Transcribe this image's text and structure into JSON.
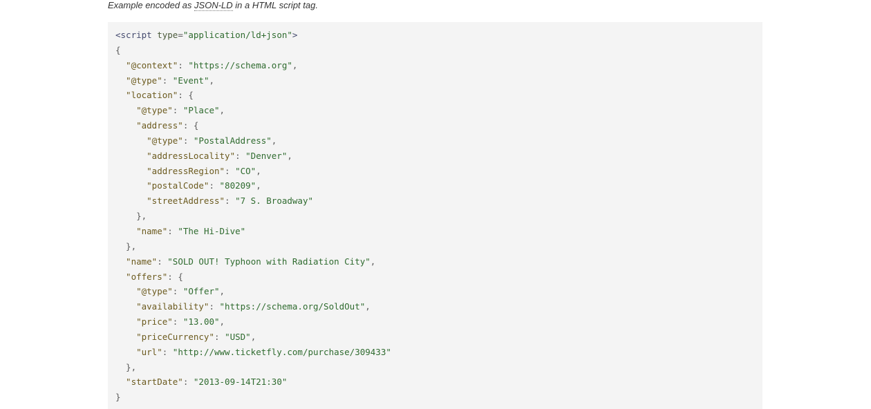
{
  "caption": {
    "prefix": "Example encoded as ",
    "term": "JSON-LD",
    "suffix": " in a HTML script tag."
  },
  "code": {
    "lines": [
      [
        {
          "t": "<script ",
          "c": "tag"
        },
        {
          "t": "type",
          "c": "attr"
        },
        {
          "t": "=",
          "c": "punc"
        },
        {
          "t": "\"application/ld+json\"",
          "c": "str"
        },
        {
          "t": ">",
          "c": "tag"
        }
      ],
      [
        {
          "t": "{",
          "c": "punc"
        }
      ],
      [
        {
          "t": "  \"@context\"",
          "c": "key"
        },
        {
          "t": ": ",
          "c": "punc"
        },
        {
          "t": "\"https://schema.org\"",
          "c": "str"
        },
        {
          "t": ",",
          "c": "punc"
        }
      ],
      [
        {
          "t": "  \"@type\"",
          "c": "key"
        },
        {
          "t": ": ",
          "c": "punc"
        },
        {
          "t": "\"Event\"",
          "c": "str"
        },
        {
          "t": ",",
          "c": "punc"
        }
      ],
      [
        {
          "t": "  \"location\"",
          "c": "key"
        },
        {
          "t": ": {",
          "c": "punc"
        }
      ],
      [
        {
          "t": "    \"@type\"",
          "c": "key"
        },
        {
          "t": ": ",
          "c": "punc"
        },
        {
          "t": "\"Place\"",
          "c": "str"
        },
        {
          "t": ",",
          "c": "punc"
        }
      ],
      [
        {
          "t": "    \"address\"",
          "c": "key"
        },
        {
          "t": ": {",
          "c": "punc"
        }
      ],
      [
        {
          "t": "      \"@type\"",
          "c": "key"
        },
        {
          "t": ": ",
          "c": "punc"
        },
        {
          "t": "\"PostalAddress\"",
          "c": "str"
        },
        {
          "t": ",",
          "c": "punc"
        }
      ],
      [
        {
          "t": "      \"addressLocality\"",
          "c": "key"
        },
        {
          "t": ": ",
          "c": "punc"
        },
        {
          "t": "\"Denver\"",
          "c": "str"
        },
        {
          "t": ",",
          "c": "punc"
        }
      ],
      [
        {
          "t": "      \"addressRegion\"",
          "c": "key"
        },
        {
          "t": ": ",
          "c": "punc"
        },
        {
          "t": "\"CO\"",
          "c": "str"
        },
        {
          "t": ",",
          "c": "punc"
        }
      ],
      [
        {
          "t": "      \"postalCode\"",
          "c": "key"
        },
        {
          "t": ": ",
          "c": "punc"
        },
        {
          "t": "\"80209\"",
          "c": "str"
        },
        {
          "t": ",",
          "c": "punc"
        }
      ],
      [
        {
          "t": "      \"streetAddress\"",
          "c": "key"
        },
        {
          "t": ": ",
          "c": "punc"
        },
        {
          "t": "\"7 S. Broadway\"",
          "c": "str"
        }
      ],
      [
        {
          "t": "    },",
          "c": "punc"
        }
      ],
      [
        {
          "t": "    \"name\"",
          "c": "key"
        },
        {
          "t": ": ",
          "c": "punc"
        },
        {
          "t": "\"The Hi-Dive\"",
          "c": "str"
        }
      ],
      [
        {
          "t": "  },",
          "c": "punc"
        }
      ],
      [
        {
          "t": "  \"name\"",
          "c": "key"
        },
        {
          "t": ": ",
          "c": "punc"
        },
        {
          "t": "\"SOLD OUT! Typhoon with Radiation City\"",
          "c": "str"
        },
        {
          "t": ",",
          "c": "punc"
        }
      ],
      [
        {
          "t": "  \"offers\"",
          "c": "key"
        },
        {
          "t": ": {",
          "c": "punc"
        }
      ],
      [
        {
          "t": "    \"@type\"",
          "c": "key"
        },
        {
          "t": ": ",
          "c": "punc"
        },
        {
          "t": "\"Offer\"",
          "c": "str"
        },
        {
          "t": ",",
          "c": "punc"
        }
      ],
      [
        {
          "t": "    \"availability\"",
          "c": "key"
        },
        {
          "t": ": ",
          "c": "punc"
        },
        {
          "t": "\"https://schema.org/SoldOut\"",
          "c": "str"
        },
        {
          "t": ",",
          "c": "punc"
        }
      ],
      [
        {
          "t": "    \"price\"",
          "c": "key"
        },
        {
          "t": ": ",
          "c": "punc"
        },
        {
          "t": "\"13.00\"",
          "c": "str"
        },
        {
          "t": ",",
          "c": "punc"
        }
      ],
      [
        {
          "t": "    \"priceCurrency\"",
          "c": "key"
        },
        {
          "t": ": ",
          "c": "punc"
        },
        {
          "t": "\"USD\"",
          "c": "str"
        },
        {
          "t": ",",
          "c": "punc"
        }
      ],
      [
        {
          "t": "    \"url\"",
          "c": "key"
        },
        {
          "t": ": ",
          "c": "punc"
        },
        {
          "t": "\"http://www.ticketfly.com/purchase/309433\"",
          "c": "str"
        }
      ],
      [
        {
          "t": "  },",
          "c": "punc"
        }
      ],
      [
        {
          "t": "  \"startDate\"",
          "c": "key"
        },
        {
          "t": ": ",
          "c": "punc"
        },
        {
          "t": "\"2013-09-14T21:30\"",
          "c": "str"
        }
      ],
      [
        {
          "t": "}",
          "c": "punc"
        }
      ]
    ]
  }
}
